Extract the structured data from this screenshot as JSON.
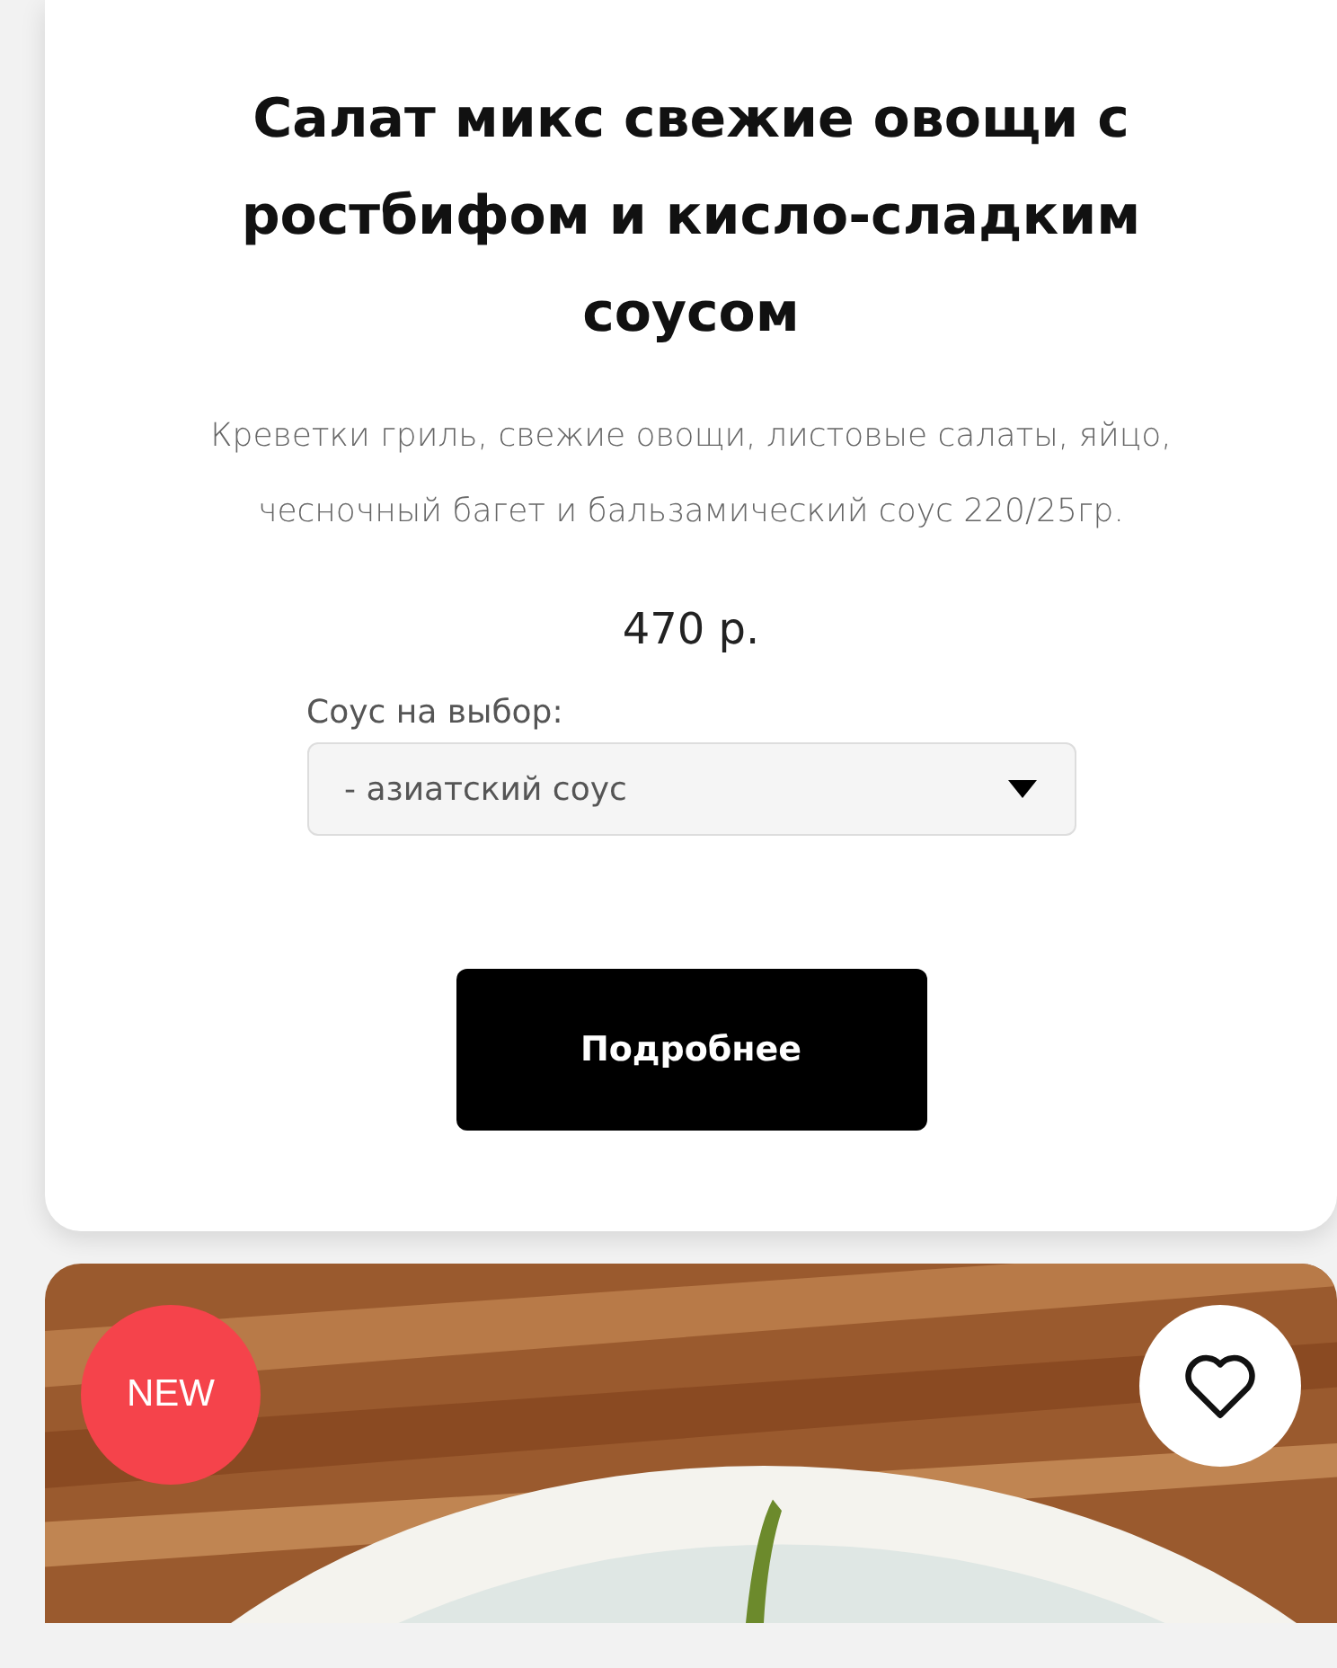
{
  "product": {
    "title": "Салат микс свежие овощи с ростбифом и кисло-сладким соусом",
    "description": "Креветки гриль, свежие овощи, листовые салаты, яйцо, чесночный багет и бальзамический соус 220/25гр.",
    "price": "470 р.",
    "option_label": "Соус на выбор:",
    "option_value": "- азиатский соус",
    "button": "Подробнее"
  },
  "next_product": {
    "badge": "NEW",
    "favorite": false
  }
}
